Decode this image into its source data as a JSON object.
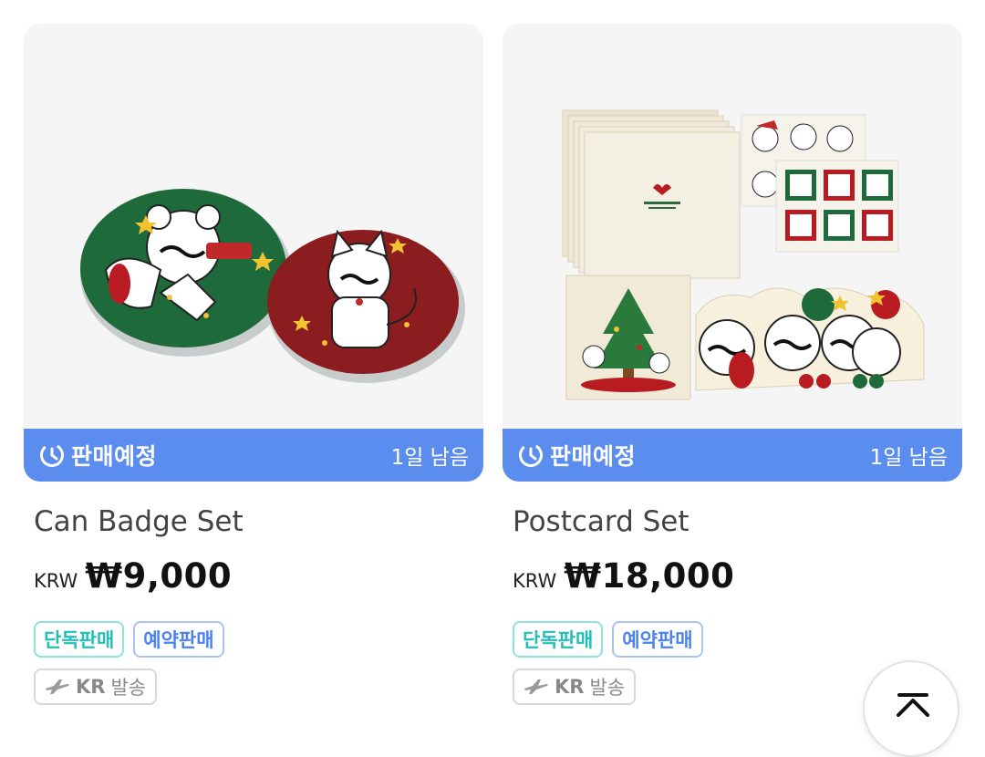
{
  "products": [
    {
      "status": "판매예정",
      "remaining": "1일 남음",
      "name": "Can Badge Set",
      "currency": "KRW",
      "price": "₩9,000",
      "tags": [
        "단독판매",
        "예약판매"
      ],
      "shipping_code": "KR",
      "shipping_label": "발송"
    },
    {
      "status": "판매예정",
      "remaining": "1일 남음",
      "name": "Postcard Set",
      "currency": "KRW",
      "price": "₩18,000",
      "tags": [
        "단독판매",
        "예약판매"
      ],
      "shipping_code": "KR",
      "shipping_label": "발송"
    }
  ],
  "colors": {
    "banner": "#5b8def",
    "exclusive_tag": "#22bfb8",
    "preorder_tag": "#4b82f0"
  },
  "icons": {
    "banner": "clock-icon",
    "shipping": "airplane-icon",
    "scroll_top": "arrow-up-to-top-icon"
  }
}
